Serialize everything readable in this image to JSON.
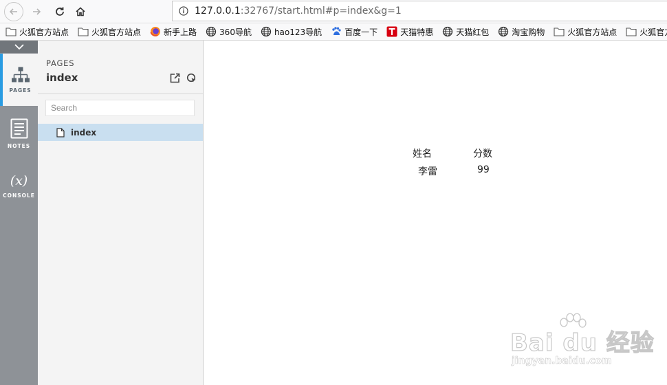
{
  "browser": {
    "url_host": "127.0.0.1",
    "url_rest": ":32767/start.html#p=index&g=1",
    "icons": [
      "back-icon",
      "forward-icon",
      "reload-icon",
      "home-icon",
      "info-icon"
    ]
  },
  "bookmarks": [
    {
      "label": "火狐官方站点",
      "icon": "folder-icon"
    },
    {
      "label": "火狐官方站点",
      "icon": "folder-icon"
    },
    {
      "label": "新手上路",
      "icon": "firefox-icon"
    },
    {
      "label": "360导航",
      "icon": "globe-icon"
    },
    {
      "label": "hao123导航",
      "icon": "globe-icon"
    },
    {
      "label": "百度一下",
      "icon": "baidu-paw-icon"
    },
    {
      "label": "天猫特惠",
      "icon": "tmall-icon"
    },
    {
      "label": "天猫红包",
      "icon": "globe-icon"
    },
    {
      "label": "淘宝购物",
      "icon": "globe-icon"
    },
    {
      "label": "火狐官方站点",
      "icon": "folder-icon"
    },
    {
      "label": "火狐官方站点",
      "icon": "folder-icon"
    }
  ],
  "rail": {
    "items": [
      {
        "label": "PAGES",
        "icon": "sitemap-icon",
        "active": true
      },
      {
        "label": "NOTES",
        "icon": "notes-icon",
        "active": false
      },
      {
        "label": "CONSOLE",
        "icon": "fx-icon",
        "glyph": "(x)",
        "active": false
      }
    ]
  },
  "panel": {
    "kicker": "PAGES",
    "title": "index",
    "search_placeholder": "Search",
    "pages": [
      {
        "name": "index",
        "selected": true
      }
    ]
  },
  "content": {
    "table": {
      "headers": [
        "姓名",
        "分数"
      ],
      "rows": [
        [
          "李雷",
          "99"
        ]
      ]
    }
  },
  "watermark": {
    "brand": "Bai du 经验",
    "url": "jingyan.baidu.com"
  },
  "colors": {
    "accent": "#2a9ce2",
    "rail_bg": "#8e9297",
    "selected_row": "#c9dff0"
  }
}
